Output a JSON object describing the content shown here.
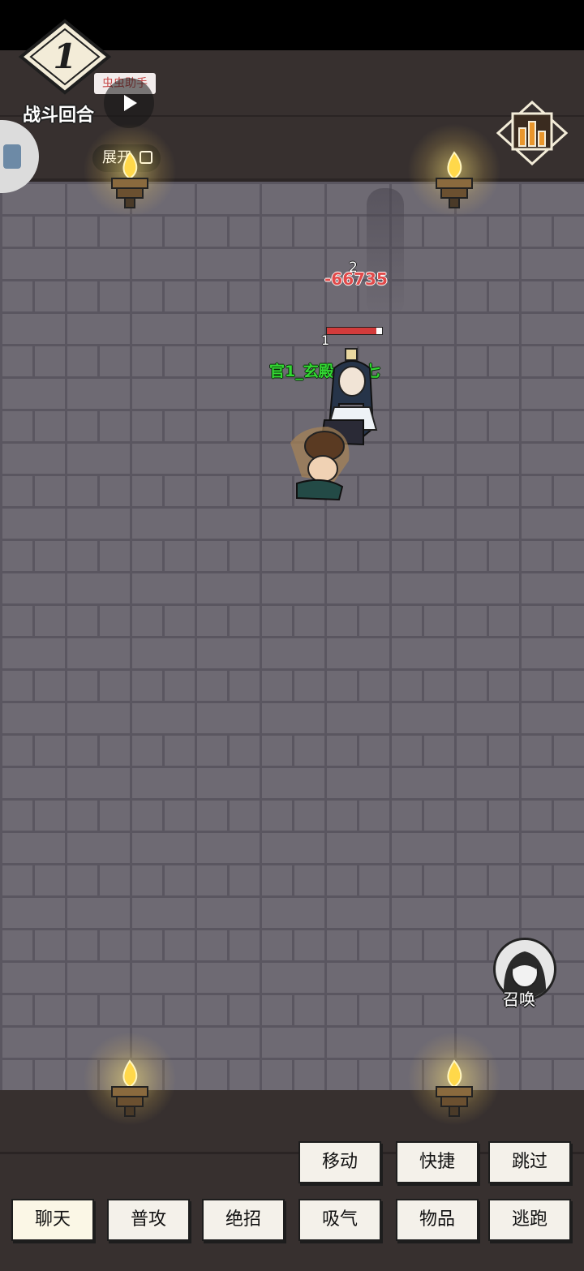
{
  "hud": {
    "round_number": "1",
    "round_label": "战斗回合",
    "assist_tag": "虫虫助手",
    "expand_label": "展开"
  },
  "battle": {
    "damage_hits": "2",
    "damage_value": "-66735",
    "target_level": "1",
    "target_hp": 0.9,
    "player_name": "官1_玄殿丨丶七"
  },
  "summon": {
    "label": "召唤"
  },
  "actions": {
    "top_row": [
      "移动",
      "快捷",
      "跳过"
    ],
    "bottom_row": [
      "聊天",
      "普攻",
      "绝招",
      "吸气",
      "物品",
      "逃跑"
    ]
  },
  "colors": {
    "floor": "#6e6a73",
    "wall": "#37302f",
    "player_name": "#33d833",
    "damage": "#e04a4a",
    "torch_flame": "#ffd84a"
  }
}
